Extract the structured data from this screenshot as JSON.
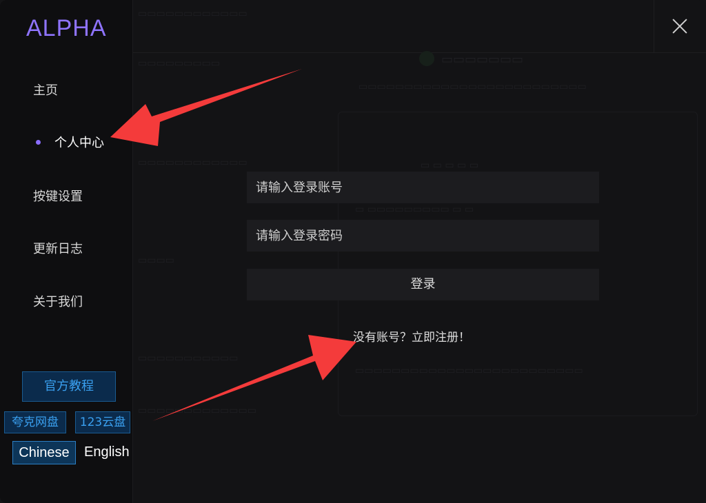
{
  "app": {
    "logo": "ALPHA"
  },
  "sidebar": {
    "items": [
      {
        "label": "主页"
      },
      {
        "label": "个人中心"
      },
      {
        "label": "按键设置"
      },
      {
        "label": "更新日志"
      },
      {
        "label": "关于我们"
      }
    ],
    "tutorial_label": "官方教程",
    "links": [
      {
        "label": "夸克网盘"
      },
      {
        "label": "123云盘"
      }
    ],
    "languages": [
      {
        "label": "Chinese",
        "active": true
      },
      {
        "label": "English",
        "active": false
      }
    ]
  },
  "login": {
    "account_placeholder": "请输入登录账号",
    "password_placeholder": "请输入登录密码",
    "submit_label": "登录",
    "register_link": "没有账号？立即注册！"
  },
  "colors": {
    "logo": "#8f74ff",
    "nav_dot": "#8a6dff",
    "link_blue": "#3aa0f0",
    "arrow_red": "#f43b3b",
    "background": "#131315"
  },
  "icons": {
    "close": "close-icon",
    "active_dot": "active-dot-icon"
  }
}
